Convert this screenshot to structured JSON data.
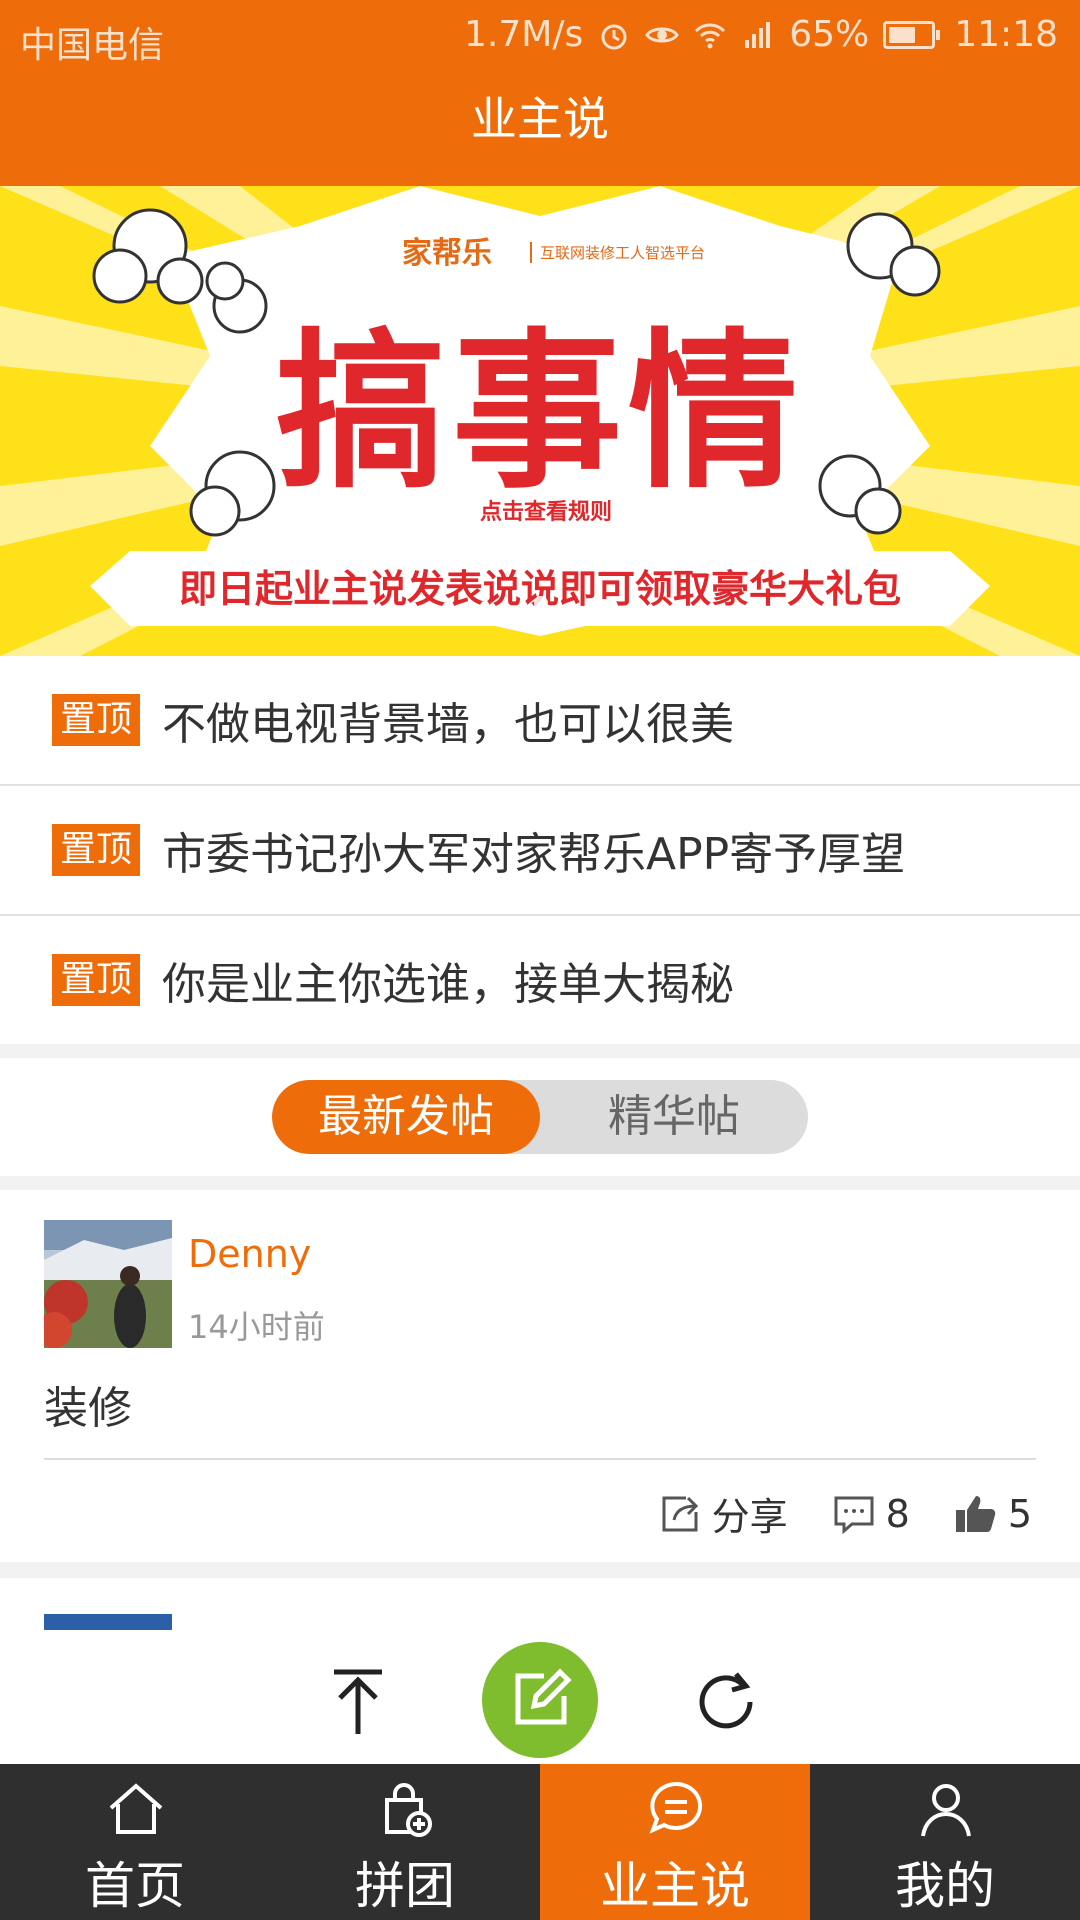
{
  "status_bar": {
    "carrier": "中国电信",
    "speed": "1.7M/s",
    "battery": "65%",
    "battery_level": 0.65,
    "time": "11:18"
  },
  "header": {
    "title": "业主说"
  },
  "banner": {
    "logo": "家帮乐",
    "logo_sub": "互联网装修工人智选平台",
    "headline": "搞事情",
    "rules_link": "点击查看规则",
    "ribbon_text": "即日起业主说发表说说即可领取豪华大礼包",
    "colors": {
      "bg": "#ffe11a",
      "text": "#e0272b"
    }
  },
  "pinned": {
    "tag": "置顶",
    "items": [
      {
        "title": "不做电视背景墙，也可以很美"
      },
      {
        "title": "市委书记孙大军对家帮乐APP寄予厚望"
      },
      {
        "title": "你是业主你选谁，接单大揭秘"
      }
    ]
  },
  "tabs": {
    "latest": "最新发帖",
    "featured": "精华帖",
    "active": "latest"
  },
  "posts": [
    {
      "author": "Denny",
      "time": "14小时前",
      "content": "装修",
      "share_label": "分享",
      "comments": "8",
      "likes": "5"
    }
  ],
  "floating_actions": {
    "icons": [
      "scroll-to-top-icon",
      "compose-icon",
      "refresh-icon"
    ],
    "compose_color": "#7fbc2e"
  },
  "nav": {
    "items": [
      {
        "label": "首页",
        "icon": "home-icon"
      },
      {
        "label": "拼团",
        "icon": "group-buy-icon"
      },
      {
        "label": "业主说",
        "icon": "chat-icon",
        "active": true
      },
      {
        "label": "我的",
        "icon": "user-icon"
      }
    ]
  },
  "colors": {
    "accent": "#ee6c0a",
    "nav_bg": "#2f2f2f"
  }
}
